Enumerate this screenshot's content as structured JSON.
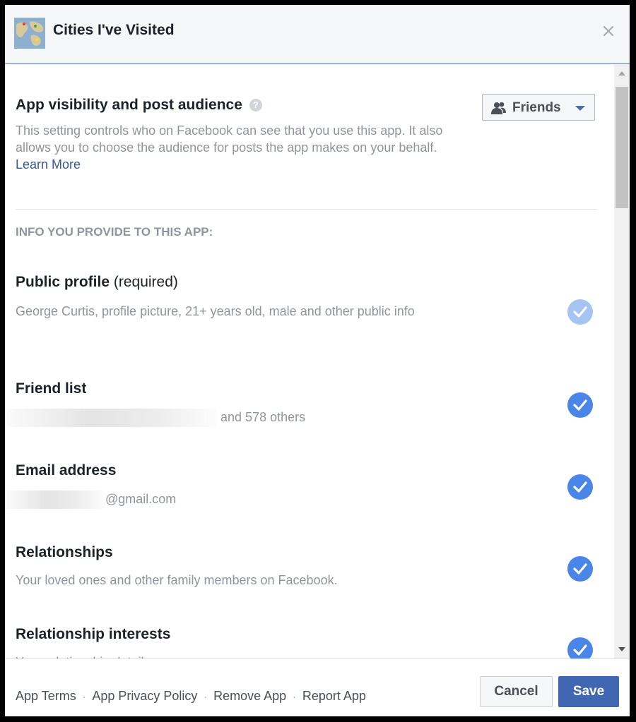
{
  "header": {
    "title": "Cities I've Visited",
    "app_icon": "world-map-icon",
    "close_icon": "close-icon"
  },
  "visibility": {
    "title": "App visibility and post audience",
    "help_icon": "question-icon",
    "description": "This setting controls who on Facebook can see that you use this app. It also allows you to choose the audience for posts the app makes on your behalf.",
    "learn_more": "Learn More",
    "audience": {
      "label": "Friends",
      "icon": "friends-icon"
    }
  },
  "section_title": "INFO YOU PROVIDE TO THIS APP:",
  "permissions": [
    {
      "title": "Public profile",
      "note": "(required)",
      "description": "George Curtis, profile picture, 21+ years old, male and other public info",
      "checked": true,
      "locked": true
    },
    {
      "title": "Friend list",
      "description": "and 578 others",
      "checked": true
    },
    {
      "title": "Email address",
      "description": "@gmail.com",
      "checked": true
    },
    {
      "title": "Relationships",
      "description": "Your loved ones and other family members on Facebook.",
      "checked": true
    },
    {
      "title": "Relationship interests",
      "description": "Your relationship details",
      "checked": true
    }
  ],
  "footer": {
    "links": [
      "App Terms",
      "App Privacy Policy",
      "Remove App",
      "Report App"
    ],
    "cancel": "Cancel",
    "save": "Save"
  },
  "colors": {
    "accent": "#4267b2",
    "check": "#4a86e8",
    "check_disabled": "#a6c4f2",
    "link": "#365899"
  }
}
